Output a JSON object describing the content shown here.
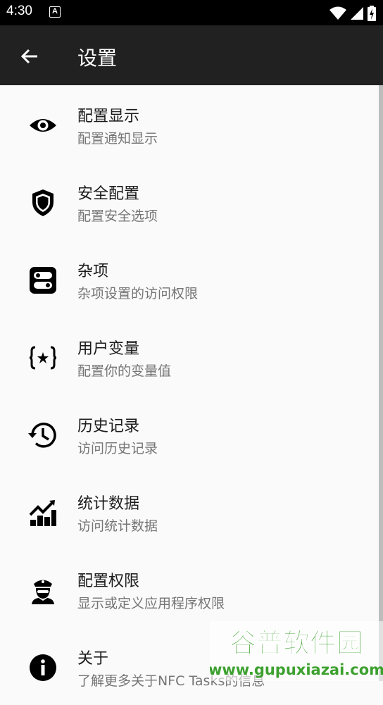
{
  "status_bar": {
    "time": "4:30",
    "notification_icon_letter": "A",
    "icons": [
      "wifi-icon",
      "signal-icon",
      "battery-charging-icon"
    ]
  },
  "app_bar": {
    "title": "设置",
    "back_icon": "arrow-back-icon"
  },
  "settings": [
    {
      "title": "配置显示",
      "subtitle": "配置通知显示",
      "icon": "eye-icon"
    },
    {
      "title": "安全配置",
      "subtitle": "配置安全选项",
      "icon": "shield-icon"
    },
    {
      "title": "杂项",
      "subtitle": "杂项设置的访问权限",
      "icon": "toggle-switches-icon"
    },
    {
      "title": "用户变量",
      "subtitle": "配置你的变量值",
      "icon": "variable-braces-icon"
    },
    {
      "title": "历史记录",
      "subtitle": "访问历史记录",
      "icon": "history-icon"
    },
    {
      "title": "统计数据",
      "subtitle": "访问统计数据",
      "icon": "stats-chart-icon"
    },
    {
      "title": "配置权限",
      "subtitle": "显示或定义应用程序权限",
      "icon": "police-officer-icon"
    },
    {
      "title": "关于",
      "subtitle": "了解更多关于NFC Tasks的信息",
      "icon": "info-icon"
    }
  ],
  "watermark": {
    "brand": "谷普软件园",
    "url": "www.gupuxiazai.com"
  },
  "colors": {
    "status_bar": "#000000",
    "app_bar": "#212121",
    "background": "#fafafa",
    "title_text": "#1b1b1b",
    "subtitle_text": "#757575",
    "watermark_green": "#3da12f"
  }
}
